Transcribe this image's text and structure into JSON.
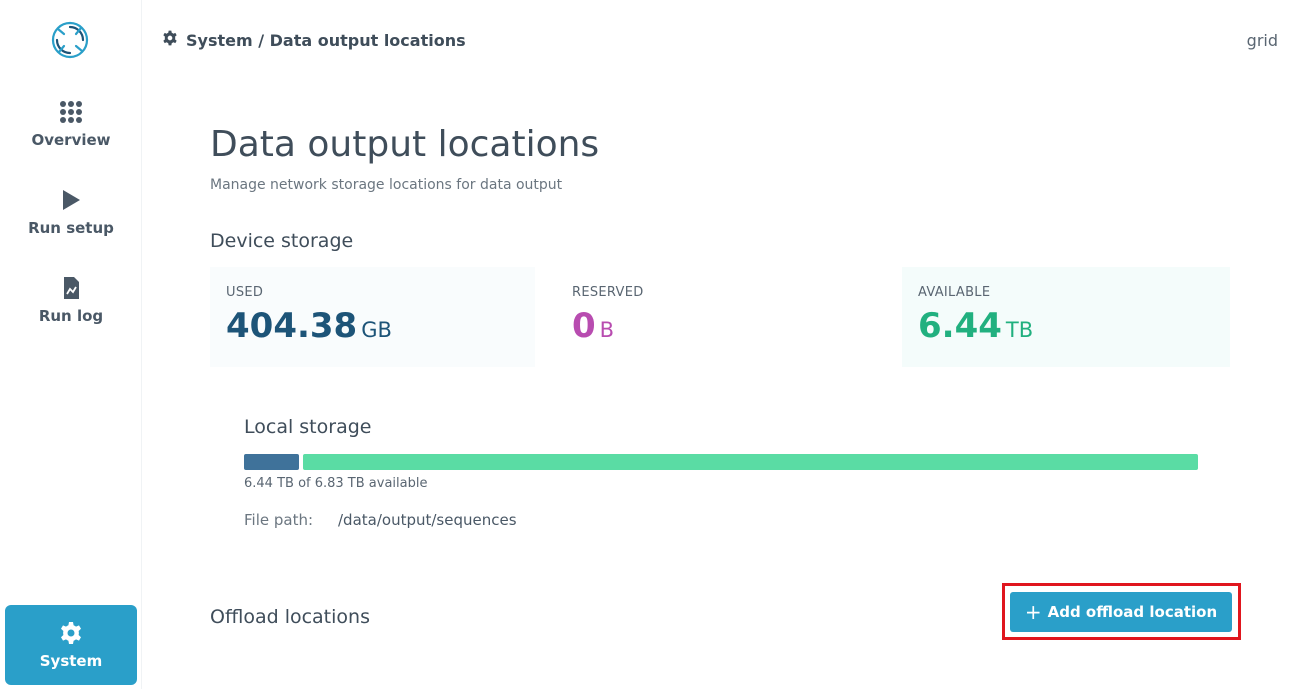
{
  "colors": {
    "accent": "#2a9fc9",
    "used": "#1d5478",
    "reserved": "#b84cb0",
    "available": "#21b07f",
    "bar_used": "#3f729a",
    "bar_free": "#5adca4",
    "highlight": "#e0161e"
  },
  "sidebar": {
    "logo": "swirl-logo-icon",
    "items": [
      {
        "label": "Overview",
        "icon": "grid-dots-icon"
      },
      {
        "label": "Run setup",
        "icon": "play-icon"
      },
      {
        "label": "Run log",
        "icon": "document-chart-icon"
      },
      {
        "label": "System",
        "icon": "gear-icon",
        "active": true
      }
    ]
  },
  "header": {
    "breadcrumb": "System / Data output locations",
    "breadcrumb_icon": "gear-icon",
    "user": "grid"
  },
  "main": {
    "title": "Data output locations",
    "subtitle": "Manage network storage locations for data output",
    "device_storage": {
      "title": "Device storage",
      "used": {
        "label": "USED",
        "value": "404.38",
        "unit": "GB"
      },
      "reserved": {
        "label": "RESERVED",
        "value": "0",
        "unit": "B"
      },
      "available": {
        "label": "AVAILABLE",
        "value": "6.44",
        "unit": "TB"
      }
    },
    "local_storage": {
      "title": "Local storage",
      "used_fraction": 0.058,
      "caption": "6.44 TB of 6.83 TB available",
      "path_label": "File path:",
      "path_value": "/data/output/sequences"
    },
    "offload": {
      "title": "Offload locations",
      "add_button": "Add offload location",
      "add_icon": "plus-icon"
    }
  }
}
